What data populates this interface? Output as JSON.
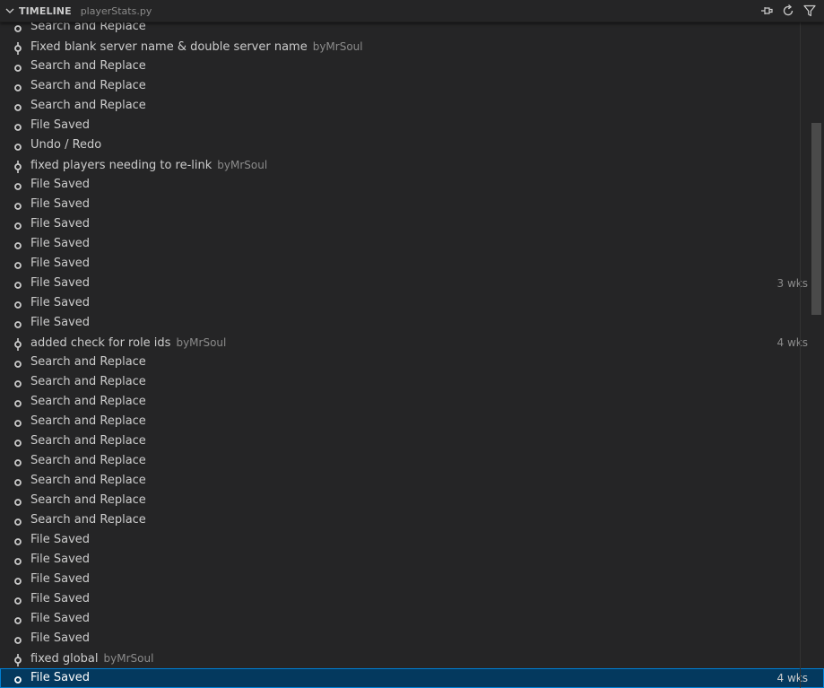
{
  "header": {
    "title": "TIMELINE",
    "file": "playerStats.py",
    "icons": [
      "chevron-down",
      "pin",
      "refresh",
      "filter"
    ]
  },
  "entries": [
    {
      "label": "Search and Replace",
      "author": "",
      "time": "",
      "kind": "local"
    },
    {
      "label": "Fixed blank server name & double server name",
      "author": "byMrSoul",
      "time": "",
      "kind": "commit"
    },
    {
      "label": "Search and Replace",
      "author": "",
      "time": "",
      "kind": "local"
    },
    {
      "label": "Search and Replace",
      "author": "",
      "time": "",
      "kind": "local"
    },
    {
      "label": "Search and Replace",
      "author": "",
      "time": "",
      "kind": "local"
    },
    {
      "label": "File Saved",
      "author": "",
      "time": "",
      "kind": "local"
    },
    {
      "label": "Undo / Redo",
      "author": "",
      "time": "",
      "kind": "local"
    },
    {
      "label": "fixed players needing to re-link",
      "author": "byMrSoul",
      "time": "",
      "kind": "commit"
    },
    {
      "label": "File Saved",
      "author": "",
      "time": "",
      "kind": "local"
    },
    {
      "label": "File Saved",
      "author": "",
      "time": "",
      "kind": "local"
    },
    {
      "label": "File Saved",
      "author": "",
      "time": "",
      "kind": "local"
    },
    {
      "label": "File Saved",
      "author": "",
      "time": "",
      "kind": "local"
    },
    {
      "label": "File Saved",
      "author": "",
      "time": "",
      "kind": "local"
    },
    {
      "label": "File Saved",
      "author": "",
      "time": "3 wks",
      "kind": "local"
    },
    {
      "label": "File Saved",
      "author": "",
      "time": "",
      "kind": "local"
    },
    {
      "label": "File Saved",
      "author": "",
      "time": "",
      "kind": "local"
    },
    {
      "label": "added check for role ids",
      "author": "byMrSoul",
      "time": "4 wks",
      "kind": "commit"
    },
    {
      "label": "Search and Replace",
      "author": "",
      "time": "",
      "kind": "local"
    },
    {
      "label": "Search and Replace",
      "author": "",
      "time": "",
      "kind": "local"
    },
    {
      "label": "Search and Replace",
      "author": "",
      "time": "",
      "kind": "local"
    },
    {
      "label": "Search and Replace",
      "author": "",
      "time": "",
      "kind": "local"
    },
    {
      "label": "Search and Replace",
      "author": "",
      "time": "",
      "kind": "local"
    },
    {
      "label": "Search and Replace",
      "author": "",
      "time": "",
      "kind": "local"
    },
    {
      "label": "Search and Replace",
      "author": "",
      "time": "",
      "kind": "local"
    },
    {
      "label": "Search and Replace",
      "author": "",
      "time": "",
      "kind": "local"
    },
    {
      "label": "Search and Replace",
      "author": "",
      "time": "",
      "kind": "local"
    },
    {
      "label": "File Saved",
      "author": "",
      "time": "",
      "kind": "local"
    },
    {
      "label": "File Saved",
      "author": "",
      "time": "",
      "kind": "local"
    },
    {
      "label": "File Saved",
      "author": "",
      "time": "",
      "kind": "local"
    },
    {
      "label": "File Saved",
      "author": "",
      "time": "",
      "kind": "local"
    },
    {
      "label": "File Saved",
      "author": "",
      "time": "",
      "kind": "local"
    },
    {
      "label": "File Saved",
      "author": "",
      "time": "",
      "kind": "local"
    },
    {
      "label": "fixed global",
      "author": "byMrSoul",
      "time": "",
      "kind": "commit"
    },
    {
      "label": "File Saved",
      "author": "",
      "time": "4 wks",
      "kind": "local",
      "selected": true
    }
  ],
  "colors": {
    "background": "#252526",
    "selection": "#04395e",
    "selection_border": "#007fd4",
    "text": "#cccccc",
    "muted": "#8b8b8b"
  }
}
